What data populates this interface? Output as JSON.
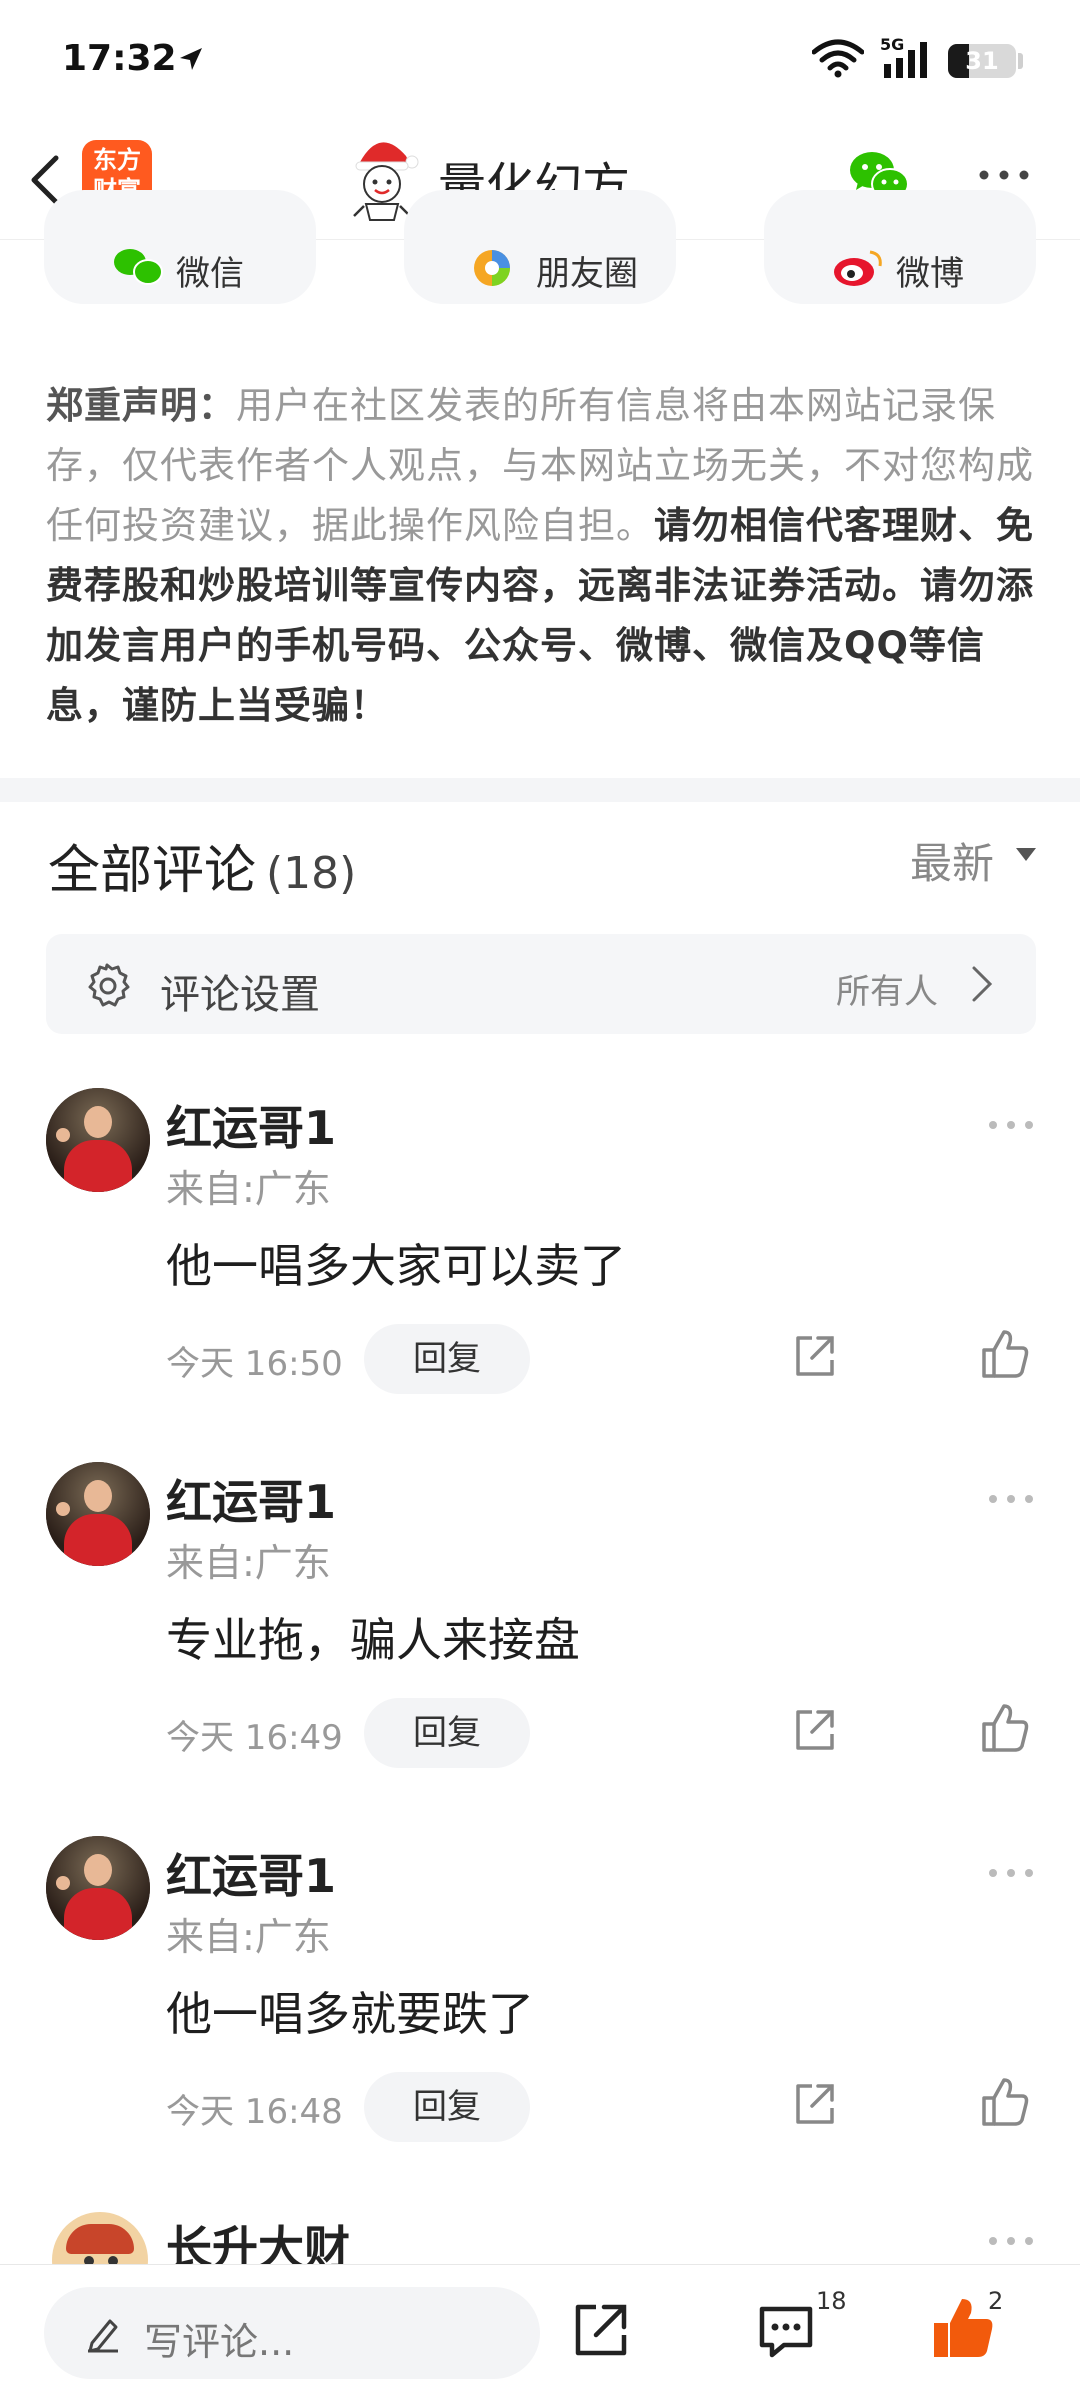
{
  "status_bar": {
    "time": "17:32",
    "network": "5G",
    "battery": "31",
    "battery_level": 0.31
  },
  "header": {
    "app_logo_text": "东方\n财富",
    "title": "量化幻方"
  },
  "share": {
    "items": [
      {
        "label": "微信",
        "icon": "wechat-icon"
      },
      {
        "label": "朋友圈",
        "icon": "moments-icon"
      },
      {
        "label": "微博",
        "icon": "weibo-icon"
      }
    ]
  },
  "disclaimer": {
    "label": "郑重声明：",
    "normal": "用户在社区发表的所有信息将由本网站记录保存，仅代表作者个人观点，与本网站立场无关，不对您构成任何投资建议，据此操作风险自担。",
    "bold": "请勿相信代客理财、免费荐股和炒股培训等宣传内容，远离非法证券活动。请勿添加发言用户的手机号码、公众号、微博、微信及QQ等信息，谨防上当受骗！"
  },
  "comments_section": {
    "title": "全部评论",
    "count": "(18)",
    "sort": "最新",
    "settings_label": "评论设置",
    "settings_value": "所有人"
  },
  "comments": [
    {
      "name": "红运哥1",
      "location": "来自:广东",
      "text": "他一唱多大家可以卖了",
      "time": "今天 16:50",
      "reply": "回复"
    },
    {
      "name": "红运哥1",
      "location": "来自:广东",
      "text": "专业拖，骗人来接盘",
      "time": "今天 16:49",
      "reply": "回复"
    },
    {
      "name": "红运哥1",
      "location": "来自:广东",
      "text": "他一唱多就要跌了",
      "time": "今天 16:48",
      "reply": "回复"
    }
  ],
  "partial_comment": {
    "name": "长升大财"
  },
  "bottom_bar": {
    "placeholder": "写评论...",
    "comment_count": "18",
    "like_count": "2"
  },
  "colors": {
    "accent_orange": "#ff5a1f",
    "like_orange": "#f25a0c",
    "wechat_green": "#2dc100"
  }
}
